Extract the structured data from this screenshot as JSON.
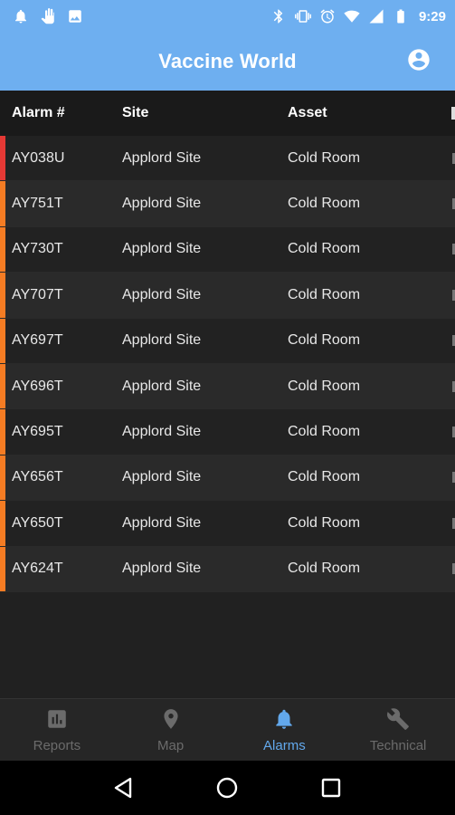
{
  "status_bar": {
    "time": "9:29",
    "left_icons": [
      "bell-icon",
      "hand-icon",
      "image-icon"
    ],
    "right_icons": [
      "bluetooth-icon",
      "vibrate-icon",
      "alarm-clock-icon",
      "wifi-icon",
      "signal-icon",
      "battery-icon"
    ]
  },
  "app_bar": {
    "title": "Vaccine World",
    "account_icon": "account-circle-icon"
  },
  "table": {
    "headers": {
      "alarm": "Alarm #",
      "site": "Site",
      "asset": "Asset"
    },
    "rows": [
      {
        "alarm": "AY038U",
        "site": "Applord Site",
        "asset": "Cold Room",
        "severity_color": "#e53935"
      },
      {
        "alarm": "AY751T",
        "site": "Applord Site",
        "asset": "Cold Room",
        "severity_color": "#f57c23"
      },
      {
        "alarm": "AY730T",
        "site": "Applord Site",
        "asset": "Cold Room",
        "severity_color": "#f57c23"
      },
      {
        "alarm": "AY707T",
        "site": "Applord Site",
        "asset": "Cold Room",
        "severity_color": "#f57c23"
      },
      {
        "alarm": "AY697T",
        "site": "Applord Site",
        "asset": "Cold Room",
        "severity_color": "#f57c23"
      },
      {
        "alarm": "AY696T",
        "site": "Applord Site",
        "asset": "Cold Room",
        "severity_color": "#f57c23"
      },
      {
        "alarm": "AY695T",
        "site": "Applord Site",
        "asset": "Cold Room",
        "severity_color": "#f57c23"
      },
      {
        "alarm": "AY656T",
        "site": "Applord Site",
        "asset": "Cold Room",
        "severity_color": "#f57c23"
      },
      {
        "alarm": "AY650T",
        "site": "Applord Site",
        "asset": "Cold Room",
        "severity_color": "#f57c23"
      },
      {
        "alarm": "AY624T",
        "site": "Applord Site",
        "asset": "Cold Room",
        "severity_color": "#f57c23"
      }
    ]
  },
  "bottom_nav": {
    "items": [
      {
        "label": "Reports",
        "icon": "bar-chart-icon",
        "active": false
      },
      {
        "label": "Map",
        "icon": "map-pin-icon",
        "active": false
      },
      {
        "label": "Alarms",
        "icon": "bell-icon",
        "active": true
      },
      {
        "label": "Technical",
        "icon": "wrench-icon",
        "active": false
      }
    ]
  },
  "colors": {
    "primary": "#6eaff0",
    "accent": "#62a8ec",
    "background": "#212121",
    "critical": "#e53935",
    "warning": "#f57c23"
  }
}
